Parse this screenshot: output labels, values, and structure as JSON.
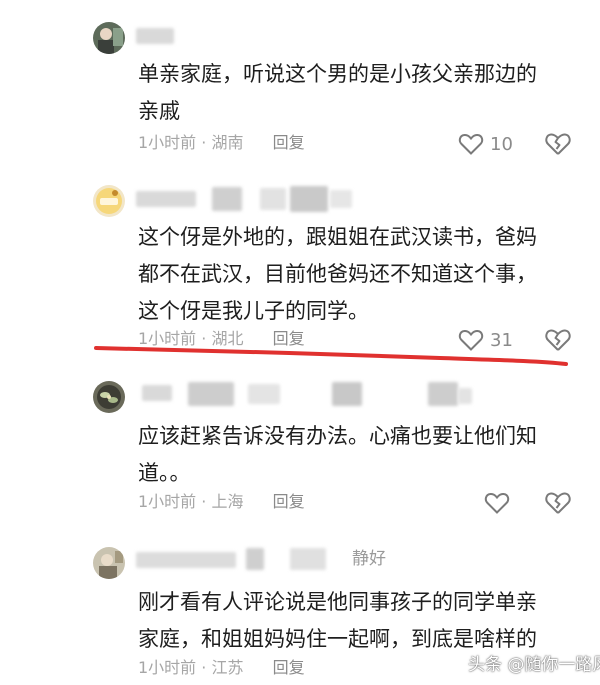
{
  "comments": [
    {
      "lines": [
        "单亲家庭，听说这个男的是小孩父亲那边的",
        "亲戚"
      ],
      "time": "1小时前",
      "location": "湖南",
      "reply_label": "回复",
      "likes": "10"
    },
    {
      "lines": [
        "这个伢是外地的，跟姐姐在武汉读书，爸妈",
        "都不在武汉，目前他爸妈还不知道这个事，",
        "这个伢是我儿子的同学。"
      ],
      "time": "1小时前",
      "location": "湖北",
      "reply_label": "回复",
      "likes": "31"
    },
    {
      "lines": [
        "应该赶紧告诉没有办法。心痛也要让他们知",
        "道。。"
      ],
      "time": "1小时前",
      "location": "上海",
      "reply_label": "回复",
      "likes": ""
    },
    {
      "username_visible": "静好",
      "lines": [
        "刚才看有人评论说是他同事孩子的同学单亲",
        "家庭，和姐姐妈妈住一起啊，到底是啥样的"
      ],
      "time": "1小时前",
      "location": "江苏",
      "reply_label": "回复",
      "likes": ""
    }
  ],
  "separator": "·",
  "watermark": "头条 @随你一路风尘",
  "colors": {
    "text": "#1e1e1e",
    "meta": "#a6a6a6",
    "annotation_underline": "#e0312f"
  },
  "icons": [
    "heart-outline-icon",
    "broken-heart-icon"
  ]
}
